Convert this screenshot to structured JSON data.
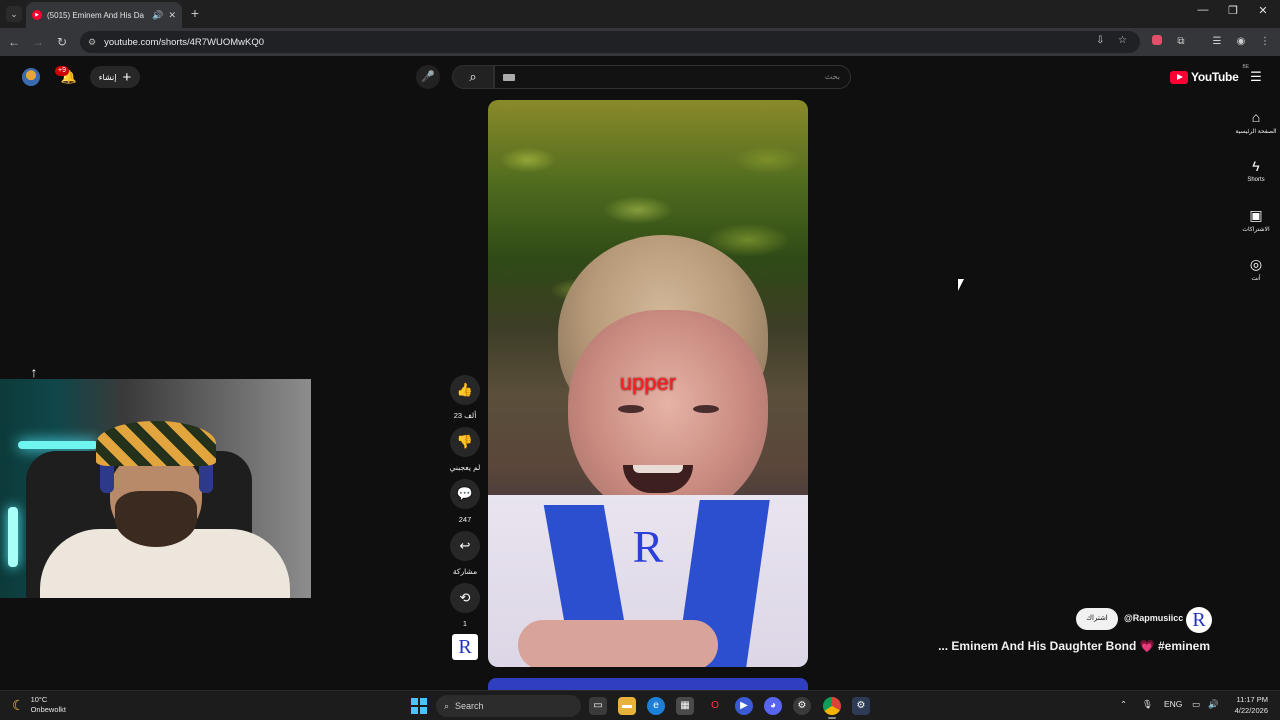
{
  "browser": {
    "tab_title": "(5015) Eminem And His Da",
    "url": "youtube.com/shorts/4R7WUOMwKQ0",
    "new_tab_label": "+",
    "window_controls": [
      "—",
      "❐",
      "✕"
    ]
  },
  "youtube": {
    "notification_badge": "+9",
    "create_label": "إنشاء",
    "search_placeholder": "بحث",
    "logo_text": "YouTube",
    "country_code": "BE",
    "guide": [
      {
        "label": "الصفحة الرئيسية",
        "icon": "home-icon"
      },
      {
        "label": "Shorts",
        "icon": "shorts-icon"
      },
      {
        "label": "الاشتراكات",
        "icon": "subscriptions-icon"
      },
      {
        "label": "أنت",
        "icon": "you-icon"
      }
    ]
  },
  "short": {
    "overlay_text": "upper",
    "overlay_letter": "R",
    "actions": {
      "like_count": "23 ألف",
      "dislike_label": "لم يعجبني",
      "comment_count": "247",
      "share_label": "مشاركة",
      "remix_count": "1"
    },
    "channel_letter": "R",
    "channel_handle": "@Rapmusiicc",
    "subscribe_label": "اشتراك",
    "title": "... Eminem And His Daughter Bond",
    "title_emoji": "💗",
    "title_hashtag": "#eminem"
  },
  "taskbar": {
    "temperature": "10°C",
    "weather_text": "Onbewolkt",
    "search_label": "Search",
    "language": "ENG",
    "time": "11:17 PM",
    "date": "4/22/2026"
  }
}
